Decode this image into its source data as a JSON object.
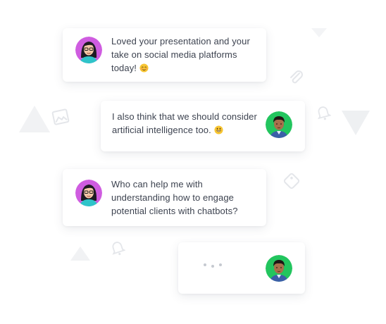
{
  "conversation": {
    "messages": [
      {
        "sender": "woman",
        "text_lines": [
          "Loved your presentation and your",
          "take on social media platforms",
          "today! "
        ],
        "emoji": "smiling-blush-emoji"
      },
      {
        "sender": "man",
        "text_lines": [
          "I also think that we should consider",
          "artificial intelligence too. "
        ],
        "emoji": "grinning-emoji"
      },
      {
        "sender": "woman",
        "text_lines": [
          "Who can help me with",
          "understanding how to engage",
          "potential clients with chatbots?"
        ]
      }
    ],
    "typing_indicator": {
      "sender": "man"
    }
  },
  "colors": {
    "woman_avatar_bg": "#cf5ce0",
    "man_avatar_bg": "#22c55e",
    "deco_gray": "#f1f2f4"
  }
}
